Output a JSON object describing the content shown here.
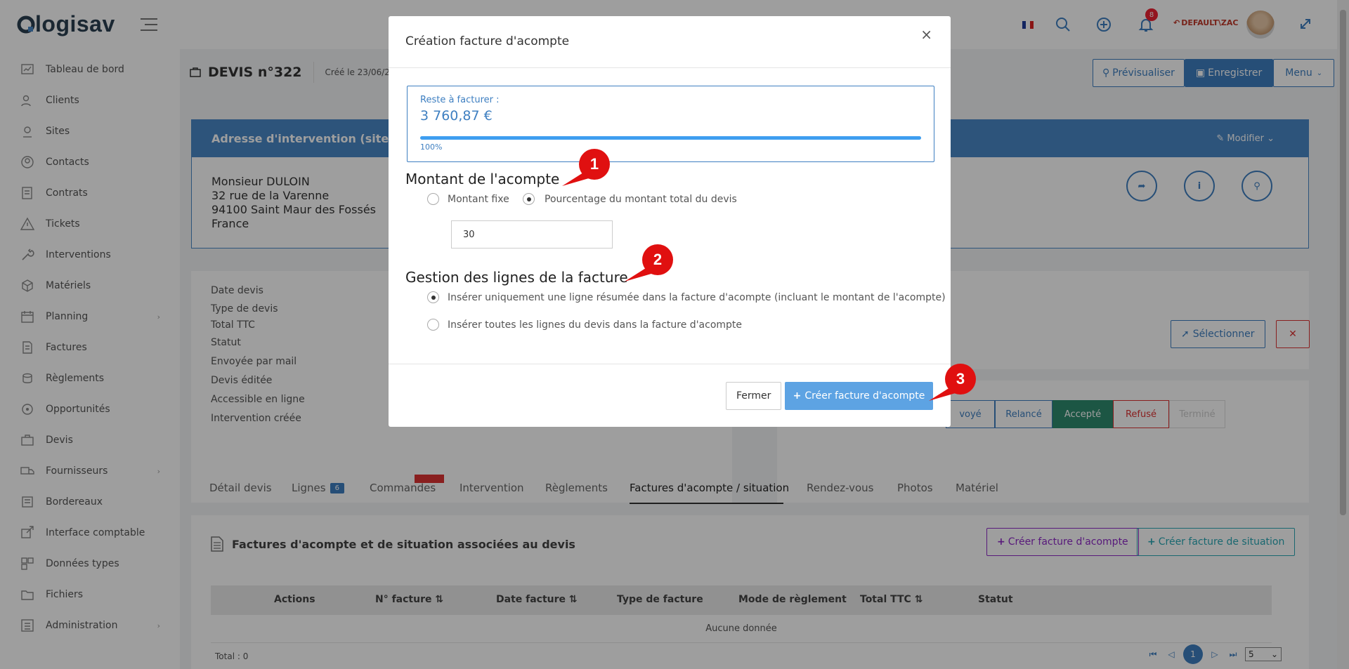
{
  "topbar": {
    "logo": "logisav",
    "user": "DEFAULT\\ZAC",
    "notification_count": "8"
  },
  "sidebar": {
    "items": [
      {
        "label": "Tableau de bord",
        "icon": "dashboard-icon"
      },
      {
        "label": "Clients",
        "icon": "users-icon"
      },
      {
        "label": "Sites",
        "icon": "map-pin-icon"
      },
      {
        "label": "Contacts",
        "icon": "contact-icon"
      },
      {
        "label": "Contrats",
        "icon": "contract-icon"
      },
      {
        "label": "Tickets",
        "icon": "warning-icon"
      },
      {
        "label": "Interventions",
        "icon": "wrench-icon"
      },
      {
        "label": "Matériels",
        "icon": "box-icon"
      },
      {
        "label": "Planning",
        "icon": "calendar-icon"
      },
      {
        "label": "Factures",
        "icon": "invoice-icon"
      },
      {
        "label": "Règlements",
        "icon": "coins-icon"
      },
      {
        "label": "Opportunités",
        "icon": "target-icon"
      },
      {
        "label": "Devis",
        "icon": "briefcase-icon"
      },
      {
        "label": "Fournisseurs",
        "icon": "truck-icon"
      },
      {
        "label": "Bordereaux",
        "icon": "stack-icon"
      },
      {
        "label": "Interface comptable",
        "icon": "external-link-icon"
      },
      {
        "label": "Données types",
        "icon": "grid-icon"
      },
      {
        "label": "Fichiers",
        "icon": "folder-icon"
      },
      {
        "label": "Administration",
        "icon": "settings-list-icon"
      }
    ]
  },
  "page": {
    "title": "DEVIS n°322",
    "created": "Créé le 23/06/2",
    "btn_preview": "Prévisualiser",
    "btn_save": "Enregistrer",
    "btn_menu": "Menu"
  },
  "address_card": {
    "header": "Adresse d'intervention (site)",
    "modify": "Modifier",
    "lines": [
      "Monsieur DULOIN",
      "32 rue de la Varenne",
      "94100 Saint Maur des Fossés",
      "France"
    ]
  },
  "details": {
    "labels": [
      "Date devis",
      "Type de devis",
      "Total TTC",
      "Statut",
      "Envoyée par mail",
      "Devis éditée",
      "Accessible en ligne",
      "Intervention créée"
    ],
    "select_btn": "Sélectionner"
  },
  "status_bar": [
    "voyé",
    "Relancé",
    "Accepté",
    "Refusé",
    "Terminé"
  ],
  "tabs": [
    {
      "label": "Détail devis"
    },
    {
      "label": "Lignes",
      "badge": "6"
    },
    {
      "label": "Commandes"
    },
    {
      "label": "Intervention"
    },
    {
      "label": "Règlements"
    },
    {
      "label": "Factures d'acompte / situation"
    },
    {
      "label": "Rendez-vous"
    },
    {
      "label": "Photos"
    },
    {
      "label": "Matériel"
    }
  ],
  "invoices_panel": {
    "title": "Factures d'acompte et de situation associées au devis",
    "btn_acompte": "Créer facture d'acompte",
    "btn_situation": "Créer facture de situation",
    "columns": [
      "Actions",
      "N° facture",
      "Date facture",
      "Type de facture",
      "Mode de règlement",
      "Total TTC",
      "Statut"
    ],
    "empty": "Aucune donnée",
    "total": "Total : 0",
    "page": "1",
    "page_size": "5"
  },
  "modal": {
    "title": "Création facture d'acompte",
    "remaining_label": "Reste à facturer :",
    "remaining_value": "3 760,87 €",
    "progress_pct": 100,
    "progress_label": "100%",
    "section1": "Montant de l'acompte",
    "opt_fixed": "Montant fixe",
    "opt_percent": "Pourcentage du montant total du devis",
    "amount_value": "30",
    "section2": "Gestion des lignes de la facture",
    "opt_summary": "Insérer uniquement une ligne résumée dans la facture d'acompte (incluant le montant de l'acompte)",
    "opt_all": "Insérer toutes les lignes du devis dans la facture d'acompte",
    "btn_close": "Fermer",
    "btn_create": "Créer facture d'acompte"
  },
  "markers": [
    "1",
    "2",
    "3"
  ],
  "colors": {
    "primary": "#3e7fc1",
    "header_blue": "#4a88c7",
    "accent_red": "#e01010",
    "accepted": "#2e8b6e"
  }
}
